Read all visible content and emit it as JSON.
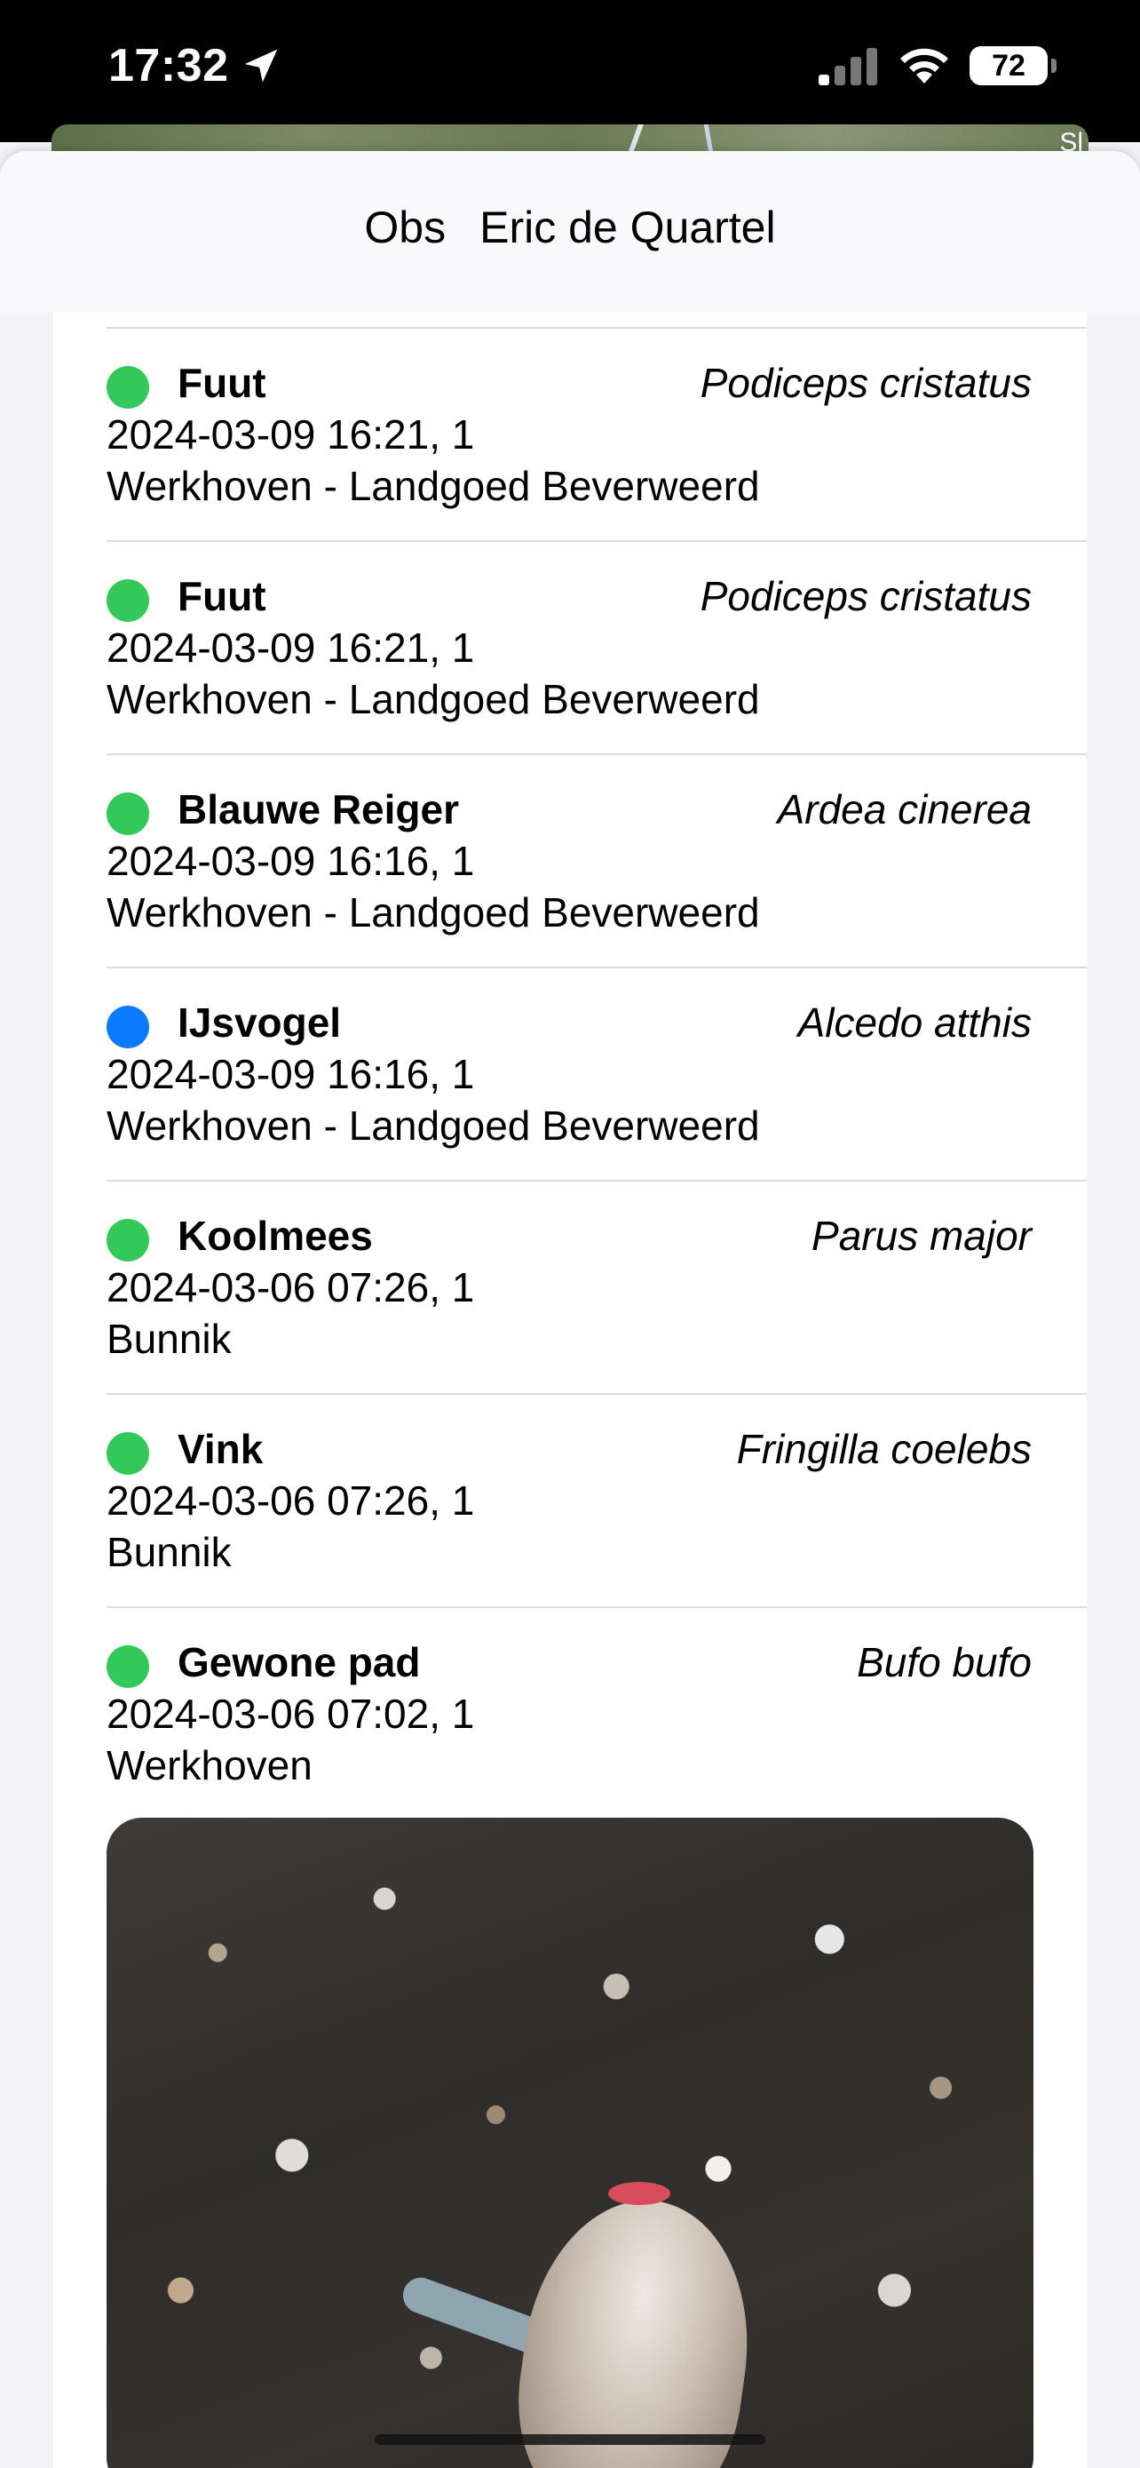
{
  "status_bar": {
    "time": "17:32",
    "battery": "72"
  },
  "map": {
    "corner_label": "Sl"
  },
  "header": {
    "title_left": "Obs",
    "title_right": "Eric de Quartel"
  },
  "colors": {
    "dot_green": "#34c759",
    "dot_blue": "#0a7aff"
  },
  "observations": [
    {
      "common": "Fuut",
      "scientific": "Podiceps cristatus",
      "when": "2024-03-09 16:21, 1",
      "where": "Werkhoven - Landgoed Beverweerd",
      "dot": "green"
    },
    {
      "common": "Fuut",
      "scientific": "Podiceps cristatus",
      "when": "2024-03-09 16:21, 1",
      "where": "Werkhoven - Landgoed Beverweerd",
      "dot": "green"
    },
    {
      "common": "Blauwe Reiger",
      "scientific": "Ardea cinerea",
      "when": "2024-03-09 16:16, 1",
      "where": "Werkhoven - Landgoed Beverweerd",
      "dot": "green"
    },
    {
      "common": "IJsvogel",
      "scientific": "Alcedo atthis",
      "when": "2024-03-09 16:16, 1",
      "where": "Werkhoven - Landgoed Beverweerd",
      "dot": "blue"
    },
    {
      "common": "Koolmees",
      "scientific": "Parus major",
      "when": "2024-03-06 07:26, 1",
      "where": "Bunnik",
      "dot": "green"
    },
    {
      "common": "Vink",
      "scientific": "Fringilla coelebs",
      "when": "2024-03-06 07:26, 1",
      "where": "Bunnik",
      "dot": "green"
    },
    {
      "common": "Gewone pad",
      "scientific": "Bufo bufo",
      "when": "2024-03-06 07:02, 1",
      "where": "Werkhoven",
      "dot": "green"
    }
  ]
}
